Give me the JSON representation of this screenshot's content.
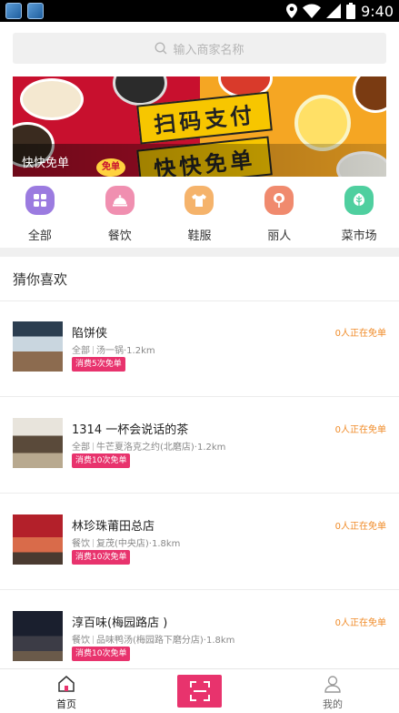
{
  "status_bar": {
    "time": "9:40"
  },
  "search": {
    "placeholder": "输入商家名称"
  },
  "banner": {
    "caption": "快快免单",
    "slogan_line1": "扫码支付",
    "slogan_line2": "快快免单",
    "badge": "免单"
  },
  "categories": [
    {
      "label": "全部",
      "icon": "grid-icon",
      "color": "#9b7be0"
    },
    {
      "label": "餐饮",
      "icon": "cloche-icon",
      "color": "#f08fb0"
    },
    {
      "label": "鞋服",
      "icon": "shirt-icon",
      "color": "#f5b36b"
    },
    {
      "label": "丽人",
      "icon": "lotus-icon",
      "color": "#f08a6e"
    },
    {
      "label": "菜市场",
      "icon": "leaf-icon",
      "color": "#4fcf9f"
    }
  ],
  "section_title": "猜你喜欢",
  "shops": [
    {
      "name": "陷饼侠",
      "category": "全部",
      "detail": "汤一锅·1.2km",
      "tag": "消费5次免单",
      "status": "0人正在免单"
    },
    {
      "name": "1314 一杯会说话的茶",
      "category": "全部",
      "detail": "牛芒夏洛克之约(北磨店)·1.2km",
      "tag": "消费10次免单",
      "status": "0人正在免单"
    },
    {
      "name": "林珍珠莆田总店",
      "category": "餐饮",
      "detail": "复茂(中央店)·1.8km",
      "tag": "消费10次免单",
      "status": "0人正在免单"
    },
    {
      "name": "淳百味(梅园路店 )",
      "category": "餐饮",
      "detail": "品味鸭汤(梅园路下磨分店)·1.8km",
      "tag": "消费10次免单",
      "status": "0人正在免单"
    }
  ],
  "tabbar": {
    "home": "首页",
    "mine": "我的"
  },
  "colors": {
    "accent": "#e8336d",
    "orange": "#f08c2a"
  }
}
